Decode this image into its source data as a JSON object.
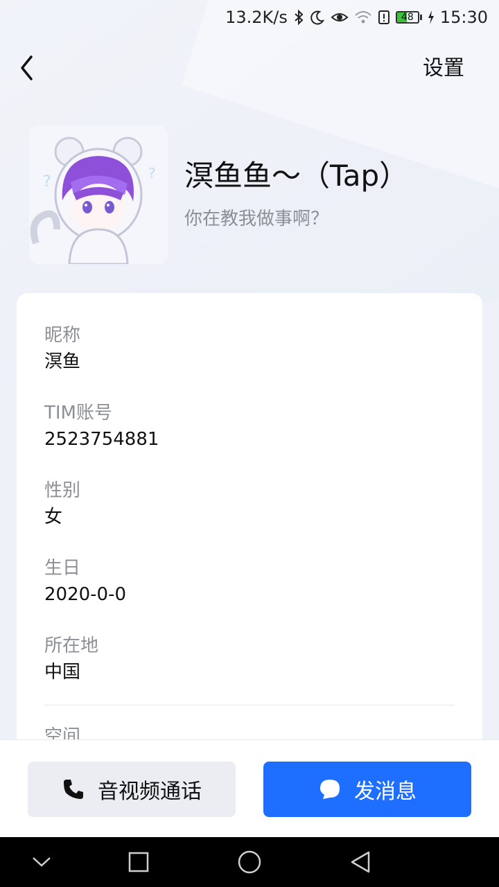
{
  "status_bar": {
    "speed": "13.2K/s",
    "battery": "48",
    "time": "15:30",
    "icons": [
      "bluetooth-icon",
      "moon-icon",
      "eye-icon",
      "wifi-icon",
      "alert-icon",
      "battery-icon",
      "charging-icon"
    ]
  },
  "header": {
    "back_icon": "chevron-left-icon",
    "settings_label": "设置"
  },
  "profile": {
    "name": "溟鱼鱼～（Tap）",
    "signature": "你在教我做事啊？"
  },
  "fields": [
    {
      "label": "昵称",
      "value": "溟鱼"
    },
    {
      "label": "TIM账号",
      "value": "2523754881"
    },
    {
      "label": "性别",
      "value": "女"
    },
    {
      "label": "生日",
      "value": "2020-0-0"
    },
    {
      "label": "所在地",
      "value": "中国"
    }
  ],
  "partial_label": "空间",
  "actions": {
    "call_label": "音视频通话",
    "message_label": "发消息"
  },
  "colors": {
    "primary": "#1E6FFF",
    "secondary_button": "#EBEDF2",
    "label_gray": "#8C8F96"
  }
}
